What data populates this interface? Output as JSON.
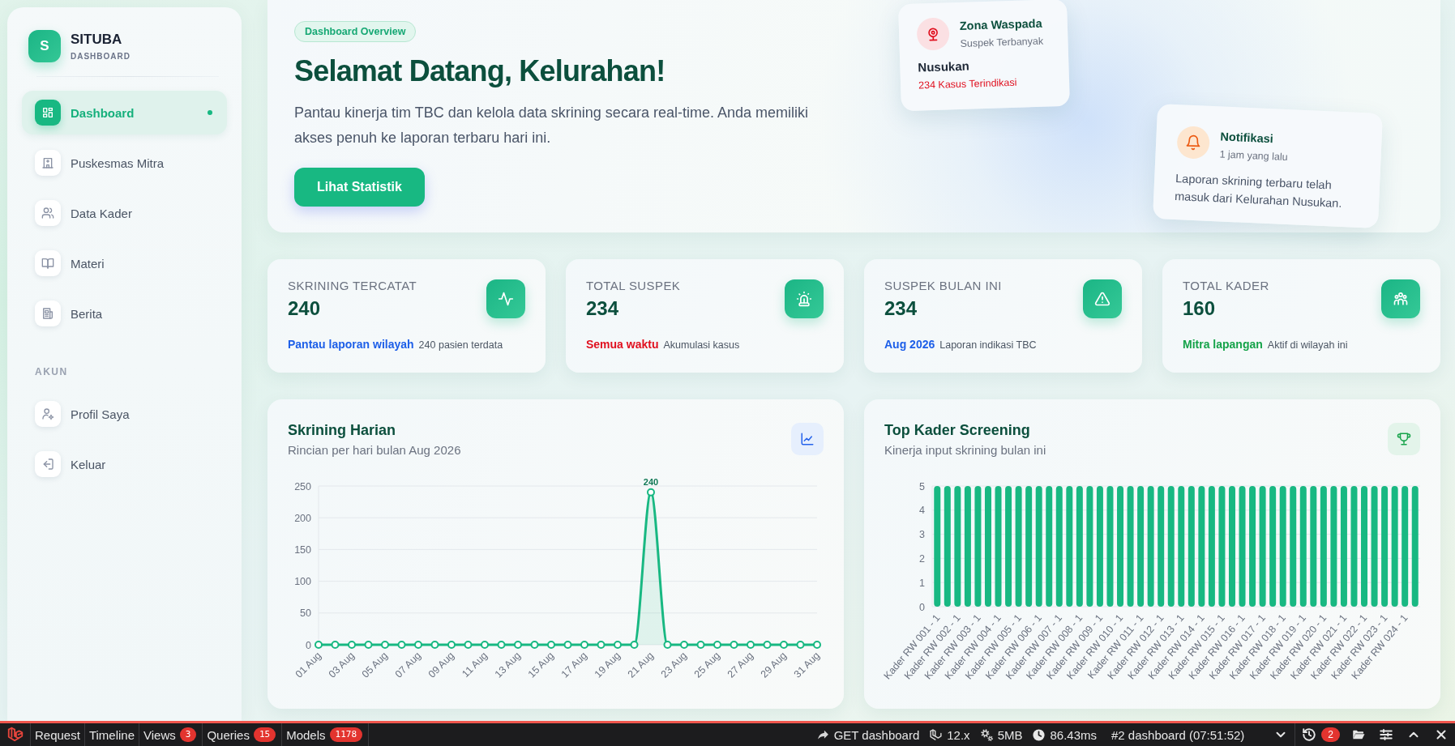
{
  "sidebar": {
    "logo": "S",
    "brand": "SITUBA",
    "subtitle": "DASHBOARD",
    "items": [
      {
        "label": "Dashboard",
        "selected": true
      },
      {
        "label": "Puskesmas Mitra",
        "selected": false
      },
      {
        "label": "Data Kader",
        "selected": false
      },
      {
        "label": "Materi",
        "selected": false
      },
      {
        "label": "Berita",
        "selected": false
      }
    ],
    "section": "AKUN",
    "account_items": [
      {
        "label": "Profil Saya",
        "selected": false
      },
      {
        "label": "Keluar",
        "selected": false
      }
    ]
  },
  "hero": {
    "badge": "Dashboard Overview",
    "title": "Selamat Datang, Kelurahan!",
    "text": "Pantau kinerja tim TBC dan kelola data skrining secara real-time. Anda memiliki akses penuh ke laporan terbaru hari ini.",
    "button": "Lihat Statistik"
  },
  "alert_card": {
    "title": "Zona Waspada",
    "subtitle": "Suspek Terbanyak",
    "area": "Nusukan",
    "cases": "234 Kasus Terindikasi"
  },
  "notification_card": {
    "title": "Notifikasi",
    "time": "1 jam yang lalu",
    "message": "Laporan skrining terbaru telah masuk dari Kelurahan Nusukan."
  },
  "stats": [
    {
      "label": "SKRINING TERCATAT",
      "value": "240",
      "highlight": "Pantau laporan wilayah",
      "color": "#1d5fe8",
      "note": "240 pasien terdata"
    },
    {
      "label": "TOTAL SUSPEK",
      "value": "234",
      "highlight": "Semua waktu",
      "color": "#e0101f",
      "note": "Akumulasi kasus"
    },
    {
      "label": "SUSPEK BULAN INI",
      "value": "234",
      "highlight": "Aug 2026",
      "color": "#1d5fe8",
      "note": "Laporan indikasi TBC"
    },
    {
      "label": "TOTAL KADER",
      "value": "160",
      "highlight": "Mitra lapangan",
      "color": "#16a34a",
      "note": "Aktif di wilayah ini"
    }
  ],
  "daily_chart": {
    "title": "Skrining Harian",
    "subtitle": "Rincian per hari bulan Aug 2026",
    "chart_data": {
      "type": "area",
      "categories": [
        "01 Aug",
        null,
        "03 Aug",
        null,
        "05 Aug",
        null,
        "07 Aug",
        null,
        "09 Aug",
        null,
        "11 Aug",
        null,
        "13 Aug",
        null,
        "15 Aug",
        null,
        "17 Aug",
        null,
        "19 Aug",
        null,
        "21 Aug",
        null,
        "23 Aug",
        null,
        "25 Aug",
        null,
        "27 Aug",
        null,
        "29 Aug",
        null,
        "31 Aug"
      ],
      "series": [
        {
          "color": "#18b882",
          "marker": true,
          "values": [
            0,
            0,
            0,
            0,
            0,
            0,
            0,
            0,
            0,
            0,
            0,
            0,
            0,
            0,
            0,
            0,
            0,
            0,
            0,
            0,
            240,
            0,
            0,
            0,
            0,
            0,
            0,
            0,
            0,
            0,
            0
          ]
        }
      ],
      "ylim": [
        0,
        250
      ],
      "yticks": [
        0,
        50,
        100,
        150,
        200,
        250
      ],
      "grid": true,
      "value_labels": [
        null,
        null,
        null,
        null,
        null,
        null,
        null,
        null,
        null,
        null,
        null,
        null,
        null,
        null,
        null,
        null,
        null,
        null,
        null,
        null,
        "240",
        null,
        null,
        null,
        null,
        null,
        null,
        null,
        null,
        null,
        null
      ]
    }
  },
  "kader_chart": {
    "title": "Top Kader Screening",
    "subtitle": "Kinerja input skrining bulan ini",
    "chart_data": {
      "type": "bar",
      "categories": [
        "Kader RW 001 - 1",
        null,
        "Kader RW 002 - 1",
        null,
        "Kader RW 003 - 1",
        null,
        "Kader RW 004 - 1",
        null,
        "Kader RW 005 - 1",
        null,
        "Kader RW 006 - 1",
        null,
        "Kader RW 007 - 1",
        null,
        "Kader RW 008 - 1",
        null,
        "Kader RW 009 - 1",
        null,
        "Kader RW 010 - 1",
        null,
        "Kader RW 011 - 1",
        null,
        "Kader RW 012 - 1",
        null,
        "Kader RW 013 - 1",
        null,
        "Kader RW 014 - 1",
        null,
        "Kader RW 015 - 1",
        null,
        "Kader RW 016 - 1",
        null,
        "Kader RW 017 - 1",
        null,
        "Kader RW 018 - 1",
        null,
        "Kader RW 019 - 1",
        null,
        "Kader RW 020 - 1",
        null,
        "Kader RW 021 - 1",
        null,
        "Kader RW 022 - 1",
        null,
        "Kader RW 023 - 1",
        null,
        "Kader RW 024 - 1",
        null
      ],
      "series": [
        {
          "color": "#18b882",
          "values": [
            5,
            5,
            5,
            5,
            5,
            5,
            5,
            5,
            5,
            5,
            5,
            5,
            5,
            5,
            5,
            5,
            5,
            5,
            5,
            5,
            5,
            5,
            5,
            5,
            5,
            5,
            5,
            5,
            5,
            5,
            5,
            5,
            5,
            5,
            5,
            5,
            5,
            5,
            5,
            5,
            5,
            5,
            5,
            5,
            5,
            5,
            5,
            5
          ]
        }
      ],
      "ylim": [
        0,
        5
      ],
      "yticks": [
        0,
        1,
        2,
        3,
        4,
        5
      ],
      "grid": true
    }
  },
  "debug_bar": {
    "tabs": [
      {
        "label": "Request"
      },
      {
        "label": "Timeline"
      },
      {
        "label": "Views",
        "count": "3"
      },
      {
        "label": "Queries",
        "count": "15"
      },
      {
        "label": "Models",
        "count": "1178"
      }
    ],
    "status": [
      "GET dashboard",
      "12.x",
      "5MB",
      "86.43ms"
    ],
    "request": "#2 dashboard (07:51:52)",
    "history_count": "2"
  }
}
